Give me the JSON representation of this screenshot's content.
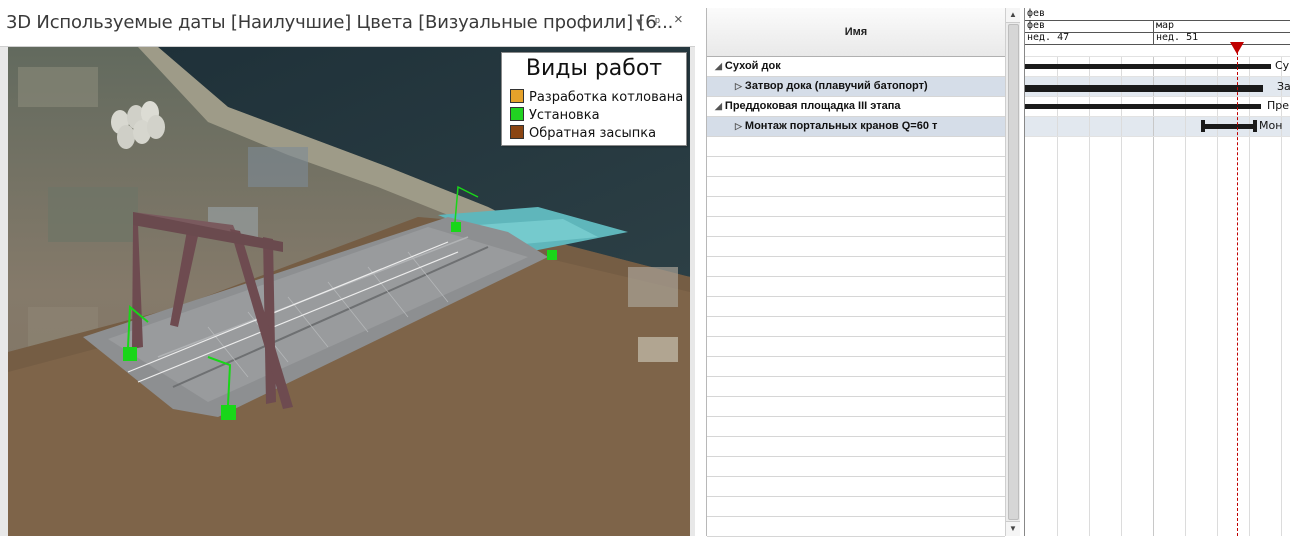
{
  "viewer": {
    "title": "3D Используемые даты [Наилучшие] Цвета [Визуальные профили]  [6...",
    "controls": {
      "dropdown": "▾",
      "pin": "ᵖ",
      "close": "×"
    }
  },
  "legend": {
    "title": "Виды работ",
    "items": [
      {
        "label": "Разработка котлована",
        "color": "#e6a22a"
      },
      {
        "label": "Установка",
        "color": "#21d321"
      },
      {
        "label": "Обратная засыпка",
        "color": "#8b4513"
      }
    ]
  },
  "grid": {
    "column_header": "Имя",
    "rows": [
      {
        "glyph": "◢",
        "label": "Сухой док",
        "indent": 1
      },
      {
        "glyph": "▷",
        "label": "Затвор дока (плавучий батопорт)",
        "indent": 2,
        "selected": true
      },
      {
        "glyph": "◢",
        "label": "Преддоковая площадка III этапа",
        "indent": 1
      },
      {
        "glyph": "▷",
        "label": "Монтаж портальных кранов Q=60 т",
        "indent": 2,
        "selected": true
      }
    ],
    "scroll": {
      "up": "▲",
      "down": "▼"
    }
  },
  "gantt": {
    "timescale": {
      "row1": [
        "фев"
      ],
      "row2": [
        "фев",
        "мар"
      ],
      "row3": [
        "нед. 47",
        "нед. 51"
      ]
    },
    "bar_labels": [
      "Су",
      "За",
      "Пре",
      "Мон"
    ]
  }
}
